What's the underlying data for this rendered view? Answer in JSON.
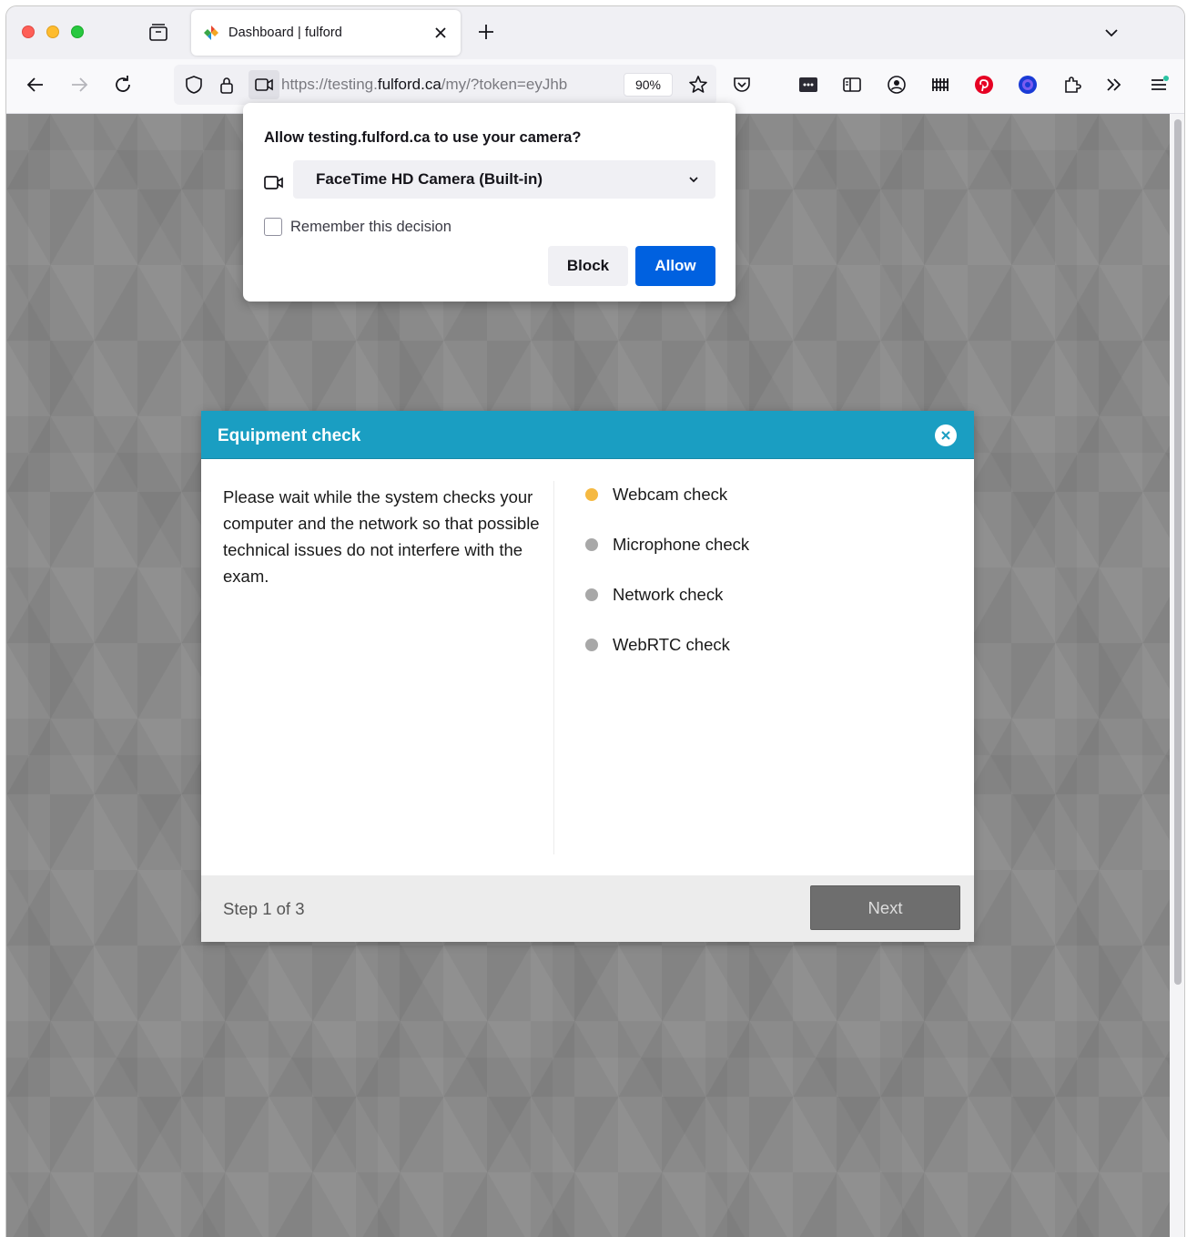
{
  "browser": {
    "tab": {
      "title": "Dashboard | fulford",
      "favicon": "fulford-logo-icon"
    },
    "url": {
      "prefix": "https://testing.",
      "domain": "fulford.ca",
      "path": "/my/?token=eyJhb"
    },
    "zoom": "90%"
  },
  "permission_popup": {
    "title": "Allow testing.fulford.ca to use your camera?",
    "camera_selected": "FaceTime HD Camera (Built-in)",
    "remember_label": "Remember this decision",
    "remember_checked": false,
    "block_label": "Block",
    "allow_label": "Allow",
    "allow_color": "#0061e0"
  },
  "modal": {
    "title": "Equipment check",
    "header_color": "#1a9ec2",
    "description": "Please wait while the system checks your computer and the network so that possible technical issues do not interfere with the exam.",
    "checks": [
      {
        "label": "Webcam check",
        "status": "in-progress",
        "color": "#f5b942"
      },
      {
        "label": "Microphone check",
        "status": "pending",
        "color": "#a8a8a8"
      },
      {
        "label": "Network check",
        "status": "pending",
        "color": "#a8a8a8"
      },
      {
        "label": "WebRTC check",
        "status": "pending",
        "color": "#a8a8a8"
      }
    ],
    "step_text": "Step 1 of 3",
    "next_label": "Next"
  }
}
